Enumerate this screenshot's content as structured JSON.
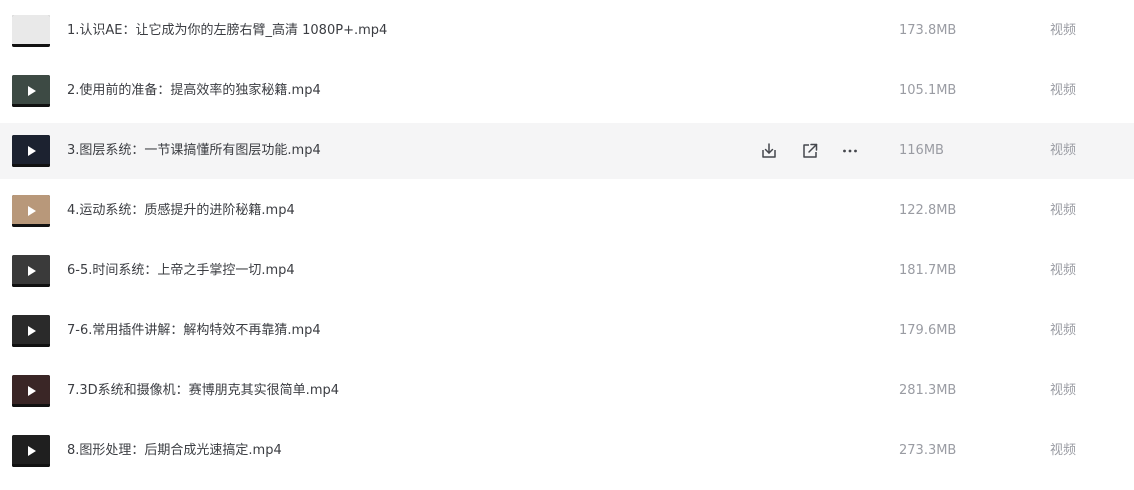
{
  "rows": [
    {
      "name": "1.认识AE：让它成为你的左膀右臂_高清 1080P+.mp4",
      "size": "173.8MB",
      "type": "视频",
      "thumb_color": "#e9e9e9",
      "has_play": false
    },
    {
      "name": "2.使用前的准备：提高效率的独家秘籍.mp4",
      "size": "105.1MB",
      "type": "视频",
      "thumb_color": "#3d4a44",
      "has_play": true
    },
    {
      "name": "3.图层系统：一节课搞懂所有图层功能.mp4",
      "size": "116MB",
      "type": "视频",
      "thumb_color": "#1c2230",
      "has_play": true
    },
    {
      "name": "4.运动系统：质感提升的进阶秘籍.mp4",
      "size": "122.8MB",
      "type": "视频",
      "thumb_color": "#b8987a",
      "has_play": true
    },
    {
      "name": "6-5.时间系统：上帝之手掌控一切.mp4",
      "size": "181.7MB",
      "type": "视频",
      "thumb_color": "#3a3a3a",
      "has_play": true
    },
    {
      "name": "7-6.常用插件讲解：解构特效不再靠猜.mp4",
      "size": "179.6MB",
      "type": "视频",
      "thumb_color": "#2a2a2a",
      "has_play": true
    },
    {
      "name": "7.3D系统和摄像机：赛博朋克其实很简单.mp4",
      "size": "281.3MB",
      "type": "视频",
      "thumb_color": "#3a2626",
      "has_play": true
    },
    {
      "name": "8.图形处理：后期合成光速搞定.mp4",
      "size": "273.3MB",
      "type": "视频",
      "thumb_color": "#1f1f1f",
      "has_play": true
    }
  ],
  "hovered_row": 2,
  "hover_actions": [
    {
      "icon": "download-icon"
    },
    {
      "icon": "share-icon"
    },
    {
      "icon": "more-icon"
    }
  ],
  "colors": {
    "hover_bg": "#f5f5f6",
    "name_text": "#3b3d42",
    "meta_text": "#9a9ca3",
    "icon": "#45474d"
  }
}
